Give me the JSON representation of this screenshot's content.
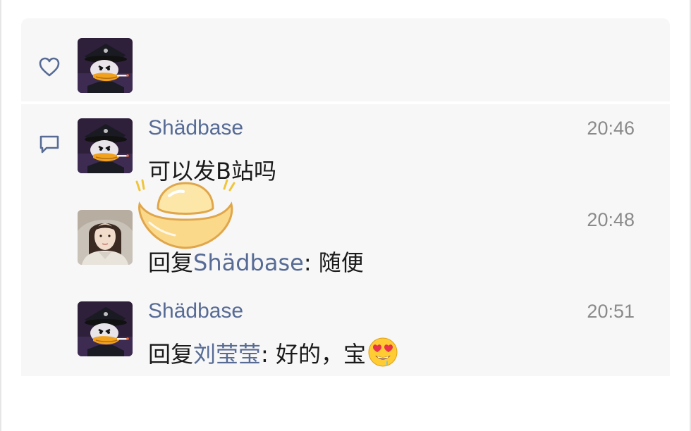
{
  "likes": {
    "avatar_icon": "donald-duck-officer-avatar"
  },
  "comments": [
    {
      "nickname": "Shädbase",
      "time": "20:46",
      "text": "可以发B站吗",
      "avatar_icon": "donald-duck-officer-avatar"
    },
    {
      "nickname": "",
      "time": "20:48",
      "reply_prefix": "回复",
      "reply_to": "Shädbase",
      "reply_text": ": 随便",
      "avatar_icon": "girl-photo-avatar"
    },
    {
      "nickname": "Shädbase",
      "time": "20:51",
      "reply_prefix": "回复",
      "reply_to": "刘莹莹",
      "reply_text": ": 好的，宝",
      "emoji": "heart-eyes-drooling-emoji",
      "avatar_icon": "donald-duck-officer-avatar"
    }
  ],
  "sticker": "gold-ingot-sticker",
  "colors": {
    "link": "#576b95",
    "card_bg": "#f7f7f7",
    "time": "#8a8a8a"
  }
}
